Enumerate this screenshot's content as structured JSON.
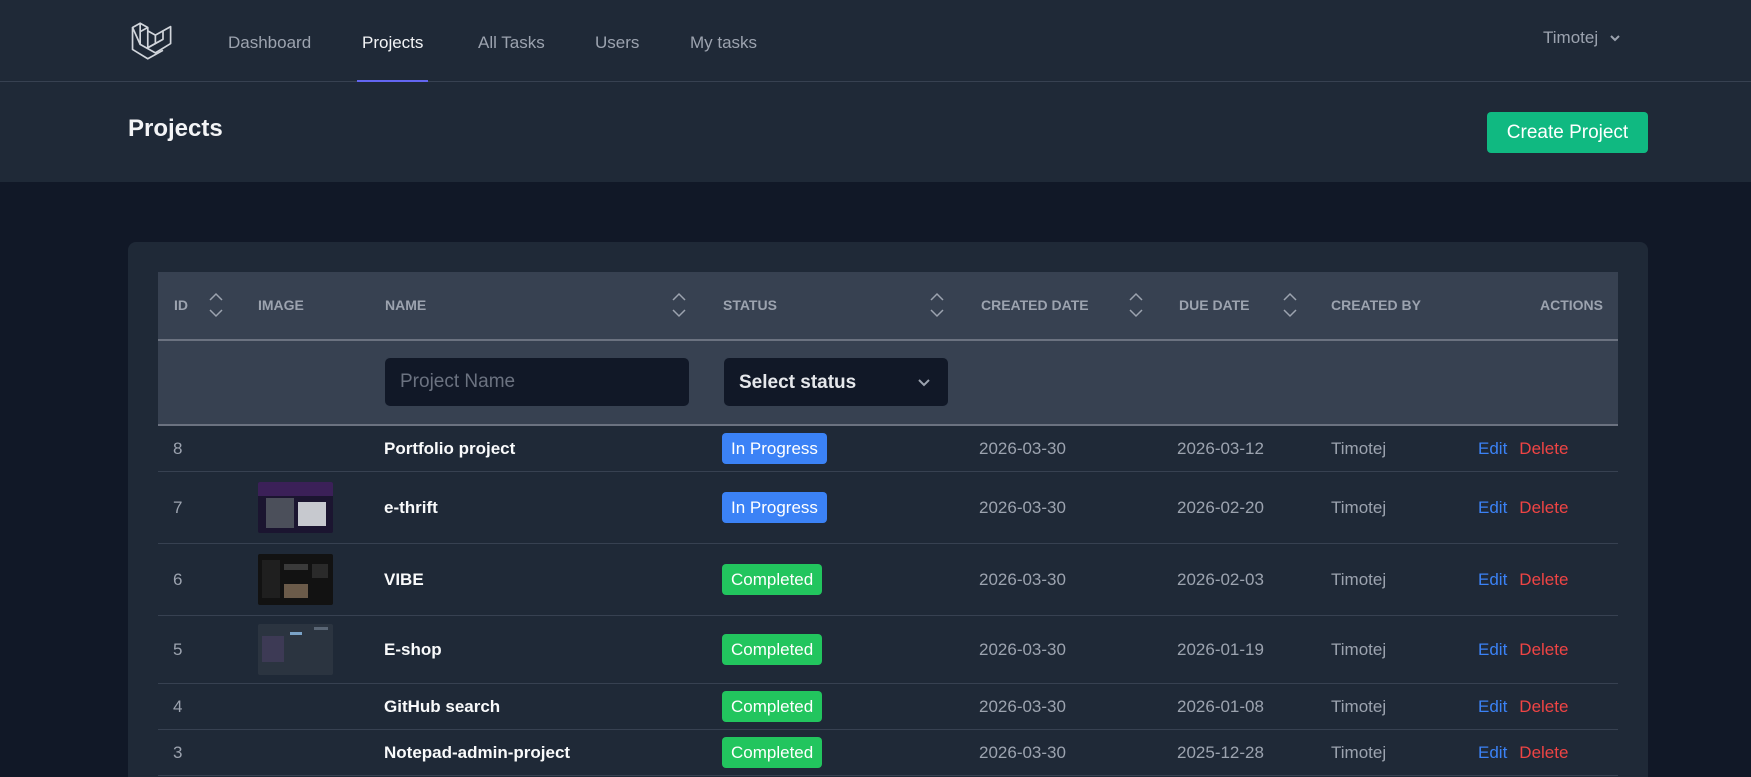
{
  "nav": {
    "links": [
      {
        "label": "Dashboard",
        "active": false
      },
      {
        "label": "Projects",
        "active": true
      },
      {
        "label": "All Tasks",
        "active": false
      },
      {
        "label": "Users",
        "active": false
      },
      {
        "label": "My tasks",
        "active": false
      }
    ],
    "user": "Timotej"
  },
  "header": {
    "title": "Projects",
    "create_label": "Create Project"
  },
  "table": {
    "columns": {
      "id": "ID",
      "image": "IMAGE",
      "name": "NAME",
      "status": "STATUS",
      "created_date": "CREATED DATE",
      "due_date": "DUE DATE",
      "created_by": "CREATED BY",
      "actions": "ACTIONS"
    },
    "filters": {
      "name_placeholder": "Project Name",
      "status_selected": "Select status"
    },
    "rows": [
      {
        "id": "8",
        "name": "Portfolio project",
        "status": "In Progress",
        "status_key": "in_progress",
        "created": "2026-03-30",
        "due": "2026-03-12",
        "created_by": "Timotej",
        "edit": "Edit",
        "delete": "Delete",
        "image": ""
      },
      {
        "id": "7",
        "name": "e-thrift",
        "status": "In Progress",
        "status_key": "in_progress",
        "created": "2026-03-30",
        "due": "2026-02-20",
        "created_by": "Timotej",
        "edit": "Edit",
        "delete": "Delete",
        "image": "thumb-ethrift"
      },
      {
        "id": "6",
        "name": "VIBE",
        "status": "Completed",
        "status_key": "completed",
        "created": "2026-03-30",
        "due": "2026-02-03",
        "created_by": "Timotej",
        "edit": "Edit",
        "delete": "Delete",
        "image": "thumb-vibe"
      },
      {
        "id": "5",
        "name": "E-shop",
        "status": "Completed",
        "status_key": "completed",
        "created": "2026-03-30",
        "due": "2026-01-19",
        "created_by": "Timotej",
        "edit": "Edit",
        "delete": "Delete",
        "image": "thumb-eshop"
      },
      {
        "id": "4",
        "name": "GitHub search",
        "status": "Completed",
        "status_key": "completed",
        "created": "2026-03-30",
        "due": "2026-01-08",
        "created_by": "Timotej",
        "edit": "Edit",
        "delete": "Delete",
        "image": ""
      },
      {
        "id": "3",
        "name": "Notepad-admin-project",
        "status": "Completed",
        "status_key": "completed",
        "created": "2026-03-30",
        "due": "2025-12-28",
        "created_by": "Timotej",
        "edit": "Edit",
        "delete": "Delete",
        "image": ""
      }
    ]
  },
  "colors": {
    "accent": "#6366f1",
    "create_button": "#10b981",
    "in_progress": "#3b82f6",
    "completed": "#22c55e",
    "edit": "#3b82f6",
    "delete": "#ef4444"
  }
}
